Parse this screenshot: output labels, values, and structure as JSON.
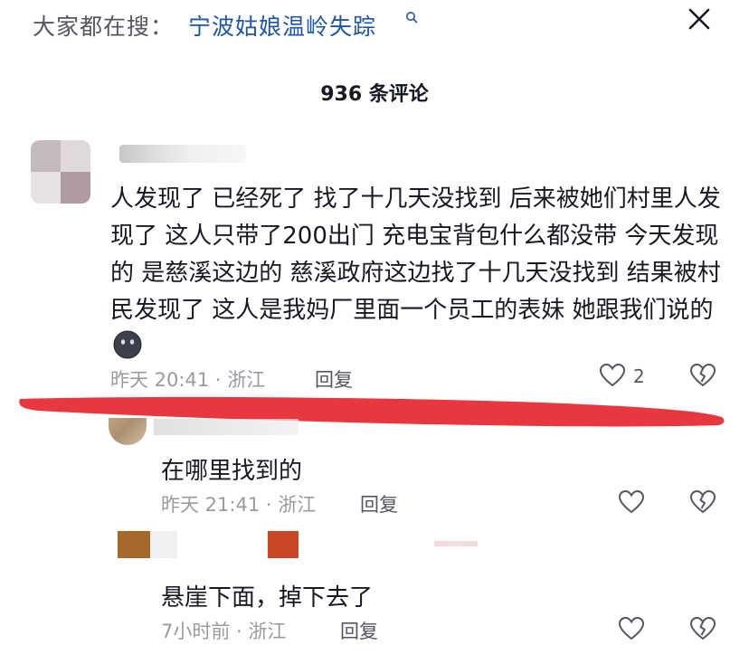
{
  "header": {
    "search_prefix": "大家都在搜：",
    "search_link": "宁波姑娘温岭失踪",
    "comment_count": "936 条评论"
  },
  "main_comment": {
    "text": "人发现了 已经死了 找了十几天没找到 后来被她们村里人发现了 这人只带了200出门 充电宝背包什么都没带 今天发现的 是慈溪这边的 慈溪政府这边找了十几天没找到 结果被村民发现了 这人是我妈厂里面一个员工的表妹 她跟我们说的",
    "emoji_icon": "dark-face-emoji-icon",
    "meta": "昨天 20:41 · 浙江",
    "reply_label": "回复",
    "like_count": "2"
  },
  "replies": [
    {
      "text": "在哪里找到的",
      "meta": "昨天 21:41 · 浙江",
      "reply_label": "回复"
    },
    {
      "text": "悬崖下面，掉下去了",
      "meta": "7小时前 · 浙江",
      "reply_label": "回复"
    }
  ],
  "colors": {
    "text": "#161823",
    "meta": "#9a9ba0",
    "link": "#1f55a8",
    "annotation_red": "#e8373f"
  },
  "icons": [
    "search-mini-icon",
    "close-icon",
    "heart-icon",
    "broken-heart-icon"
  ]
}
